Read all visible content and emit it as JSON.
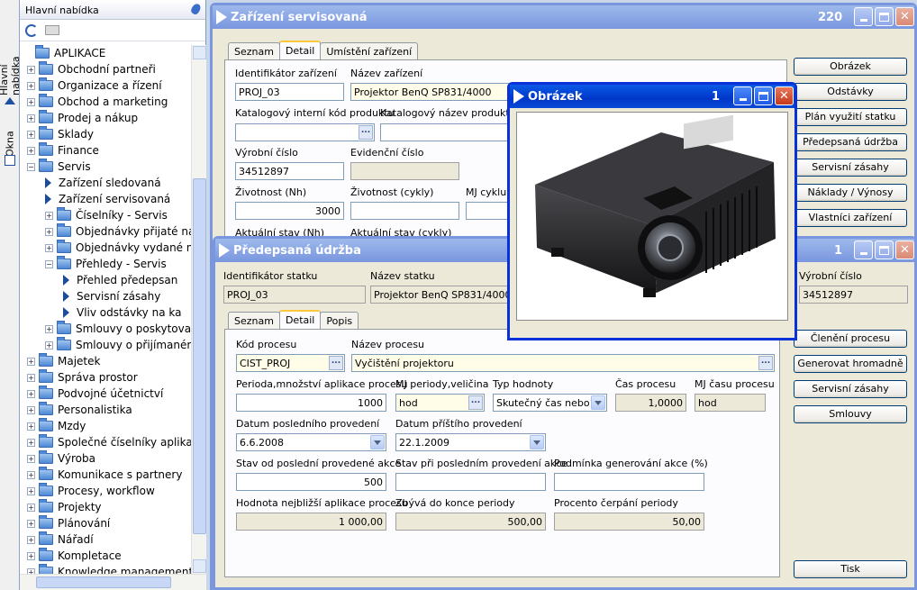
{
  "side_tabs": {
    "main_menu": "Hlavní nabídka",
    "windows": "Okna"
  },
  "menu": {
    "title": "Hlavní nabídka",
    "tree": [
      {
        "label": "APLIKACE",
        "level": 0,
        "kind": "root"
      },
      {
        "label": "Obchodní partneři",
        "level": 1,
        "kind": "folder"
      },
      {
        "label": "Organizace a řízení",
        "level": 1,
        "kind": "folder"
      },
      {
        "label": "Obchod a marketing",
        "level": 1,
        "kind": "folder"
      },
      {
        "label": "Prodej a nákup",
        "level": 1,
        "kind": "folder"
      },
      {
        "label": "Sklady",
        "level": 1,
        "kind": "folder"
      },
      {
        "label": "Finance",
        "level": 1,
        "kind": "folder"
      },
      {
        "label": "Servis",
        "level": 1,
        "kind": "folder-open"
      },
      {
        "label": "Zařízení sledovaná",
        "level": 2,
        "kind": "item"
      },
      {
        "label": "Zařízení servisovaná",
        "level": 2,
        "kind": "item"
      },
      {
        "label": "Číselníky - Servis",
        "level": 2,
        "kind": "folder"
      },
      {
        "label": "Objednávky přijaté na",
        "level": 2,
        "kind": "folder"
      },
      {
        "label": "Objednávky vydané na",
        "level": 2,
        "kind": "folder"
      },
      {
        "label": "Přehledy - Servis",
        "level": 2,
        "kind": "folder-open"
      },
      {
        "label": "Přehled předepsan",
        "level": 3,
        "kind": "item"
      },
      {
        "label": "Servisní zásahy",
        "level": 3,
        "kind": "item"
      },
      {
        "label": "Vliv odstávky na ka",
        "level": 3,
        "kind": "item"
      },
      {
        "label": "Smlouvy o poskytovan",
        "level": 2,
        "kind": "folder"
      },
      {
        "label": "Smlouvy o přijímaném",
        "level": 2,
        "kind": "folder"
      },
      {
        "label": "Majetek",
        "level": 1,
        "kind": "folder"
      },
      {
        "label": "Správa prostor",
        "level": 1,
        "kind": "folder"
      },
      {
        "label": "Podvojné účetnictví",
        "level": 1,
        "kind": "folder"
      },
      {
        "label": "Personalistika",
        "level": 1,
        "kind": "folder"
      },
      {
        "label": "Mzdy",
        "level": 1,
        "kind": "folder"
      },
      {
        "label": "Společné číselníky aplikac",
        "level": 1,
        "kind": "folder"
      },
      {
        "label": "Výroba",
        "level": 1,
        "kind": "folder"
      },
      {
        "label": "Komunikace s partnery",
        "level": 1,
        "kind": "folder"
      },
      {
        "label": "Procesy, workflow",
        "level": 1,
        "kind": "folder"
      },
      {
        "label": "Projekty",
        "level": 1,
        "kind": "folder"
      },
      {
        "label": "Plánování",
        "level": 1,
        "kind": "folder"
      },
      {
        "label": "Nářadí",
        "level": 1,
        "kind": "folder"
      },
      {
        "label": "Kompletace",
        "level": 1,
        "kind": "folder"
      },
      {
        "label": "Knowledge management",
        "level": 1,
        "kind": "folder"
      }
    ]
  },
  "win1": {
    "title": "Zařízení servisovaná",
    "number": "220",
    "tabs": [
      "Seznam",
      "Detail",
      "Umístění zařízení"
    ],
    "labels": {
      "id": "Identifikátor zařízení",
      "name": "Název zařízení",
      "cat_code": "Katalogový interní kód produktu",
      "cat_name": "Katalogový název produktu",
      "serial": "Výrobní číslo",
      "evidence": "Evidenční číslo",
      "life_h": "Životnost (Nh)",
      "life_c": "Životnost (cykly)",
      "mj_cycle": "MJ cyklu",
      "state_h": "Aktuální stav (Nh)",
      "state_c": "Aktuální stav (cykly)"
    },
    "values": {
      "id": "PROJ_03",
      "name": "Projektor BenQ SP831/4000",
      "serial": "34512897",
      "life_h": "3000"
    },
    "buttons": [
      "Obrázek",
      "Odstávky",
      "Plán využití statku",
      "Předepsaná údržba",
      "Servisní zásahy",
      "Náklady / Výnosy",
      "Vlastníci zařízení"
    ]
  },
  "win2": {
    "title": "Předepsaná údržba",
    "number": "1",
    "labels": {
      "asset_id": "Identifikátor statku",
      "asset_name": "Název statku",
      "serial": "Výrobní číslo"
    },
    "values": {
      "asset_id": "PROJ_03",
      "asset_name": "Projektor BenQ SP831/4000",
      "serial": "34512897"
    },
    "tabs": [
      "Seznam",
      "Detail",
      "Popis"
    ],
    "form": {
      "proc_code_l": "Kód procesu",
      "proc_code": "CIST_PROJ",
      "proc_name_l": "Název procesu",
      "proc_name": "Vyčištění projektoru",
      "period_l": "Perioda,množství aplikace procesu",
      "period": "1000",
      "mj_l": "MJ periody,veličina",
      "mj": "hod",
      "type_l": "Typ hodnoty",
      "type": "Skutečný čas nebo po",
      "time_l": "Čas procesu",
      "time": "1,0000",
      "mjtime_l": "MJ času procesu",
      "mjtime": "hod",
      "last_l": "Datum posledního provedení",
      "last": "6.6.2008",
      "next_l": "Datum příštího provedení",
      "next": "22.1.2009",
      "since_l": "Stav od poslední provedené akce",
      "since": "500",
      "at_last_l": "Stav při posledním provedení akce",
      "cond_l": "Podmínka generování akce (%)",
      "nearest_l": "Hodnota nejbližší aplikace procesu",
      "nearest": "1 000,00",
      "remain_l": "Zbývá do konce periody",
      "remain": "500,00",
      "pct_l": "Procento čerpání periody",
      "pct": "50,00"
    },
    "buttons": [
      "Členění procesu",
      "Generovat hromadně",
      "Servisní zásahy",
      "Smlouvy",
      "Tisk"
    ]
  },
  "win3": {
    "title": "Obrázek",
    "number": "1"
  },
  "colors": {
    "title_active": "#0036c8",
    "title_inactive": "#7a96df",
    "form_bg": "#ece9d8"
  }
}
